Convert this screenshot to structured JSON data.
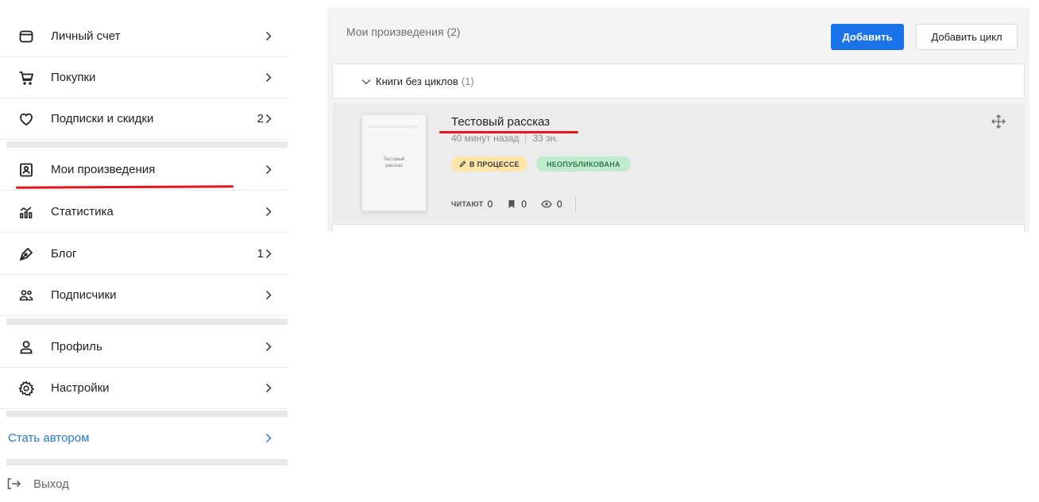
{
  "sidebar": {
    "items": [
      {
        "label": "Личный счет",
        "icon": "wallet-icon",
        "count": ""
      },
      {
        "label": "Покупки",
        "icon": "cart-icon",
        "count": ""
      },
      {
        "label": "Подписки и скидки",
        "icon": "heart-icon",
        "count": "2"
      },
      {
        "label": "Мои произведения",
        "icon": "book-user-icon",
        "count": ""
      },
      {
        "label": "Статистика",
        "icon": "chart-icon",
        "count": ""
      },
      {
        "label": "Блог",
        "icon": "pen-nib-icon",
        "count": "1"
      },
      {
        "label": "Подписчики",
        "icon": "users-icon",
        "count": ""
      },
      {
        "label": "Профиль",
        "icon": "user-icon",
        "count": ""
      },
      {
        "label": "Настройки",
        "icon": "gear-icon",
        "count": ""
      },
      {
        "label": "Стать автором",
        "icon": "",
        "count": ""
      },
      {
        "label": "Выход",
        "icon": "logout-icon",
        "count": ""
      }
    ],
    "active_item": "Мои произведения"
  },
  "main": {
    "title": "Мои произведения (2)",
    "add_button": "Добавить",
    "add_cycle_button": "Добавить цикл",
    "group": {
      "label": "Книги без циклов",
      "count": "(1)"
    },
    "book": {
      "title": "Тестовый рассказ",
      "cover_text_line1": "Тестовый",
      "cover_text_line2": "рассказ",
      "updated": "40 минут назад",
      "chars": "33 зн.",
      "status_badge": "В ПРОЦЕССЕ",
      "publish_badge": "НЕОПУБЛИКОВАНА",
      "readers_label": "ЧИТАЮТ",
      "readers": "0",
      "bookmarks": "0",
      "views": "0"
    }
  },
  "colors": {
    "accent": "#1a73e8",
    "highlight_underline": "#e8141c",
    "author_link": "#2a78d4",
    "badge_progress_bg": "#fde6a8",
    "badge_unpublished_bg": "#bfeccd"
  }
}
